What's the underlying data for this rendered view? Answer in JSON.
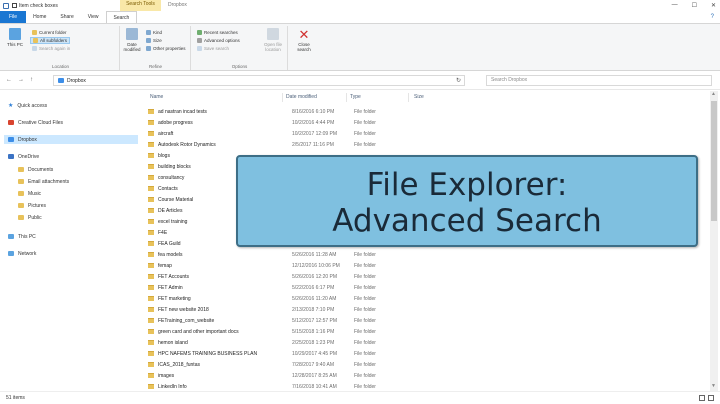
{
  "titlebar": {
    "qat_label": "Item check boxes",
    "context_tab": "Search Tools",
    "window_title": "Dropbox",
    "minimize": "—",
    "maximize": "☐",
    "close": "✕"
  },
  "tabs": {
    "file": "File",
    "home": "Home",
    "share": "Share",
    "view": "View",
    "search": "Search",
    "help": "?"
  },
  "ribbon": {
    "location": {
      "this_pc": "This PC",
      "current_folder": "Current folder",
      "all_subfolders": "All subfolders",
      "search_again": "Search again in",
      "label": "Location"
    },
    "refine": {
      "date_modified": "Date modified",
      "kind": "Kind",
      "size": "Size",
      "other_properties": "Other properties",
      "label": "Refine"
    },
    "options": {
      "recent_searches": "Recent searches",
      "advanced_options": "Advanced options",
      "save_search": "Save search",
      "open_file_location": "Open file location",
      "label": "Options"
    },
    "close": {
      "close_search": "Close search"
    }
  },
  "addressbar": {
    "back": "←",
    "forward": "→",
    "up": "↑",
    "path": "Dropbox",
    "refresh": "↻",
    "search_placeholder": "Search Dropbox"
  },
  "navpane": {
    "items": [
      {
        "label": "Quick access"
      },
      {
        "label": "Creative Cloud Files"
      },
      {
        "label": "Dropbox"
      },
      {
        "label": "OneDrive"
      },
      {
        "label": "Documents"
      },
      {
        "label": "Email attachments"
      },
      {
        "label": "Music"
      },
      {
        "label": "Pictures"
      },
      {
        "label": "Public"
      },
      {
        "label": "This PC"
      },
      {
        "label": "Network"
      }
    ]
  },
  "columns": {
    "name": "Name",
    "date": "Date modified",
    "type": "Type",
    "size": "Size"
  },
  "files": [
    {
      "name": "ad nastran incad tests",
      "date": "8/16/2016 6:10 PM",
      "type": "File folder"
    },
    {
      "name": "adobe progress",
      "date": "10/2/2016 4:44 PM",
      "type": "File folder"
    },
    {
      "name": "aircraft",
      "date": "10/2/2017 12:09 PM",
      "type": "File folder"
    },
    {
      "name": "Autodesk Rotor Dynamics",
      "date": "2/5/2017 11:16 PM",
      "type": "File folder"
    },
    {
      "name": "blogs",
      "date": "",
      "type": ""
    },
    {
      "name": "building blocks",
      "date": "",
      "type": ""
    },
    {
      "name": "consultancy",
      "date": "",
      "type": ""
    },
    {
      "name": "Contacts",
      "date": "",
      "type": ""
    },
    {
      "name": "Course Material",
      "date": "",
      "type": ""
    },
    {
      "name": "DE Articles",
      "date": "",
      "type": ""
    },
    {
      "name": "excel training",
      "date": "",
      "type": ""
    },
    {
      "name": "F4E",
      "date": "",
      "type": ""
    },
    {
      "name": "FEA Guild",
      "date": "",
      "type": ""
    },
    {
      "name": "fea models",
      "date": "5/26/2016 11:28 AM",
      "type": "File folder"
    },
    {
      "name": "femap",
      "date": "12/12/2016 10:06 PM",
      "type": "File folder"
    },
    {
      "name": "FET Accounts",
      "date": "5/26/2016 12:20 PM",
      "type": "File folder"
    },
    {
      "name": "FET Admin",
      "date": "5/22/2016 6:17 PM",
      "type": "File folder"
    },
    {
      "name": "FET marketing",
      "date": "5/26/2016 11:20 AM",
      "type": "File folder"
    },
    {
      "name": "FET new website 2018",
      "date": "2/13/2018 7:10 PM",
      "type": "File folder"
    },
    {
      "name": "FETraining_com_website",
      "date": "5/12/2017 12:57 PM",
      "type": "File folder"
    },
    {
      "name": "green card and other important docs",
      "date": "5/15/2018 1:16 PM",
      "type": "File folder"
    },
    {
      "name": "hemon island",
      "date": "2/25/2018 1:23 PM",
      "type": "File folder"
    },
    {
      "name": "HPC NAFEMS TRAINING BUSINESS PLAN",
      "date": "10/29/2017 4:45 PM",
      "type": "File folder"
    },
    {
      "name": "ICAS_2018_funtas",
      "date": "7/28/2017 9:40 AM",
      "type": "File folder"
    },
    {
      "name": "images",
      "date": "12/28/2017 8:25 AM",
      "type": "File folder"
    },
    {
      "name": "LinkedIn Info",
      "date": "7/16/2018 10:41 AM",
      "type": "File folder"
    }
  ],
  "status": {
    "items": "51 items"
  },
  "overlay": {
    "line1": "File Explorer:",
    "line2": "Advanced Search"
  },
  "colors": {
    "file_tab": "#1976d2",
    "context_tab": "#f9e8a8",
    "overlay_bg": "#7fc0e0",
    "overlay_border": "#3d6e86",
    "selected": "#cce8ff",
    "folder": "#e8c25a"
  }
}
